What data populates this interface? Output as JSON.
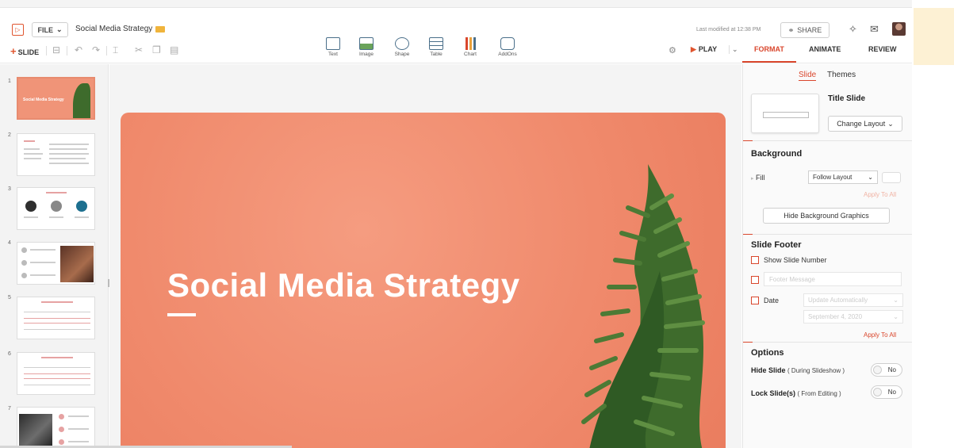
{
  "header": {
    "file_label": "FILE",
    "doc_title": "Social Media Strategy",
    "last_modified": "Last modified at 12:38 PM",
    "share_label": "SHARE"
  },
  "toolbar": {
    "slide_label": "SLIDE",
    "play_label": "PLAY",
    "insert": [
      {
        "label": "Text",
        "icon": "text-box-icon"
      },
      {
        "label": "Image",
        "icon": "image-icon"
      },
      {
        "label": "Shape",
        "icon": "shape-icon"
      },
      {
        "label": "Table",
        "icon": "table-icon"
      },
      {
        "label": "Chart",
        "icon": "chart-icon"
      },
      {
        "label": "AddOns",
        "icon": "puzzle-icon"
      }
    ]
  },
  "right_tabs": {
    "format": "FORMAT",
    "animate": "ANIMATE",
    "review": "REVIEW",
    "active": "FORMAT"
  },
  "thumbnails": {
    "numbers": [
      "1",
      "2",
      "3",
      "4",
      "5",
      "6",
      "7"
    ],
    "slide1_title": "Social Media Strategy"
  },
  "slide": {
    "title": "Social Media Strategy"
  },
  "panel": {
    "sub_tabs": {
      "slide": "Slide",
      "themes": "Themes"
    },
    "layout_name": "Title Slide",
    "change_layout": "Change Layout",
    "background": {
      "heading": "Background",
      "fill_label": "Fill",
      "fill_value": "Follow Layout",
      "apply_all": "Apply To All",
      "hide_bg": "Hide Background Graphics"
    },
    "footer": {
      "heading": "Slide Footer",
      "show_number": "Show Slide Number",
      "footer_placeholder": "Footer Message",
      "date_label": "Date",
      "date_mode": "Update Automatically",
      "date_value": "September 4, 2020",
      "apply_all": "Apply To All"
    },
    "options": {
      "heading": "Options",
      "hide_slide": "Hide Slide",
      "hide_slide_note": "( During Slideshow )",
      "hide_value": "No",
      "lock_slide": "Lock Slide(s)",
      "lock_slide_note": "( From Editing )",
      "lock_value": "No"
    }
  },
  "colors": {
    "accent": "#d9462c",
    "slide_bg": "#f08a6c",
    "plant": "#3e6b2c"
  }
}
